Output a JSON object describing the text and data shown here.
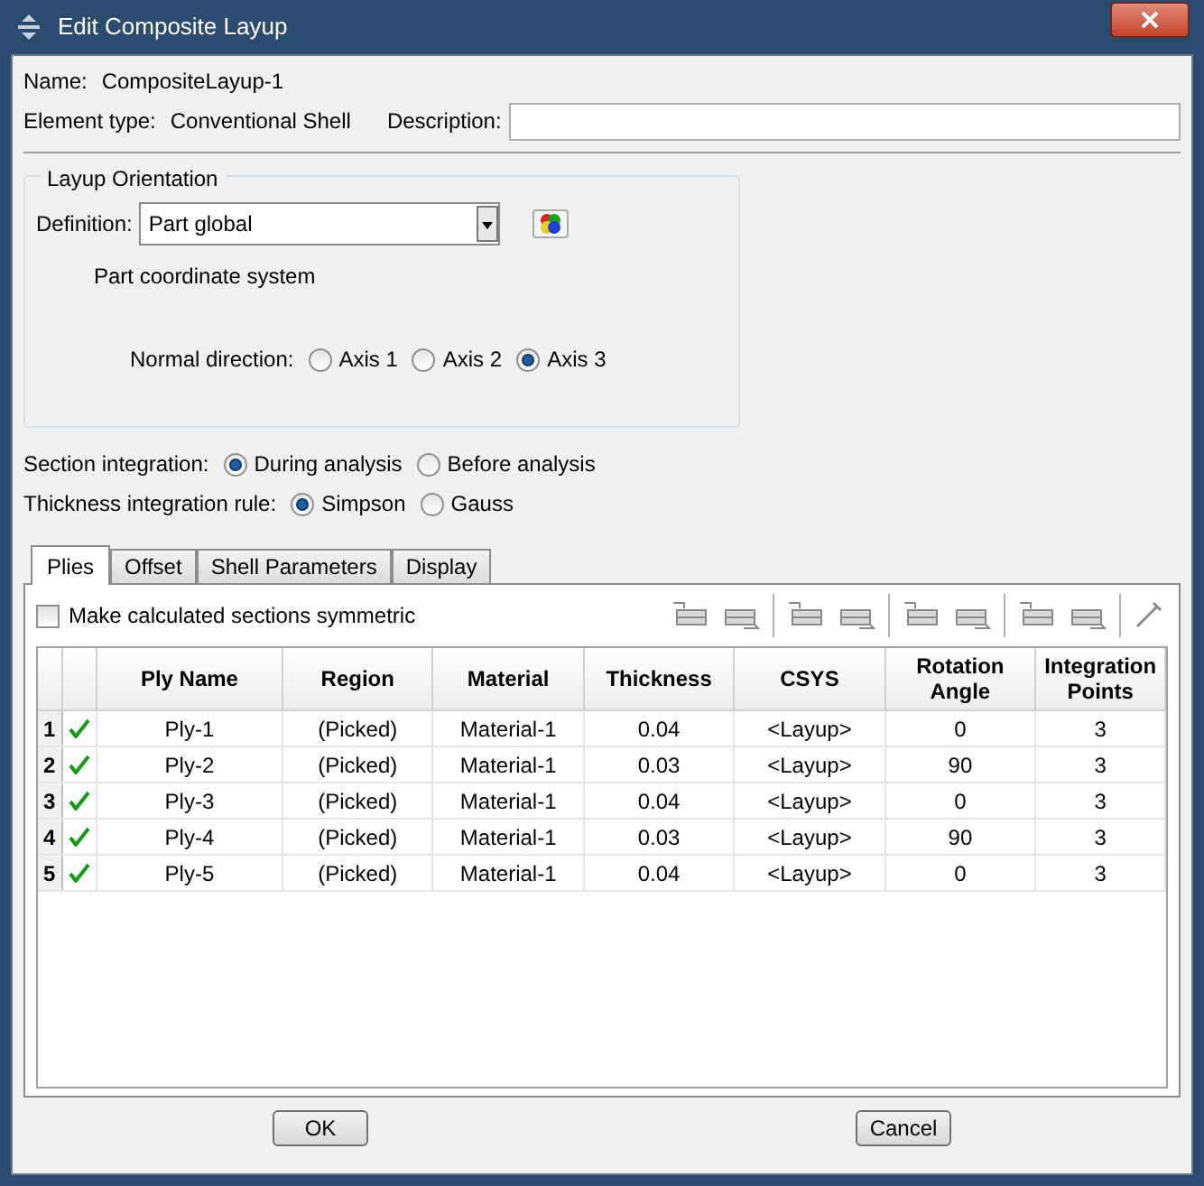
{
  "window": {
    "title": "Edit Composite Layup"
  },
  "name": {
    "label": "Name:",
    "value": "CompositeLayup-1"
  },
  "element_type": {
    "label": "Element type:",
    "value": "Conventional Shell"
  },
  "description": {
    "label": "Description:"
  },
  "layup_orientation": {
    "title": "Layup Orientation",
    "definition_label": "Definition:",
    "definition_value": "Part global",
    "note": "Part coordinate system",
    "normal_label": "Normal direction:",
    "normal_options": [
      {
        "label": "Axis 1",
        "selected": false
      },
      {
        "label": "Axis 2",
        "selected": false
      },
      {
        "label": "Axis 3",
        "selected": true
      }
    ]
  },
  "section_integration": {
    "label": "Section integration:",
    "options": [
      {
        "label": "During analysis",
        "selected": true
      },
      {
        "label": "Before analysis",
        "selected": false
      }
    ]
  },
  "thickness_rule": {
    "label": "Thickness integration rule:",
    "options": [
      {
        "label": "Simpson",
        "selected": true
      },
      {
        "label": "Gauss",
        "selected": false
      }
    ]
  },
  "tabs": [
    {
      "label": "Plies",
      "selected": true
    },
    {
      "label": "Offset",
      "selected": false
    },
    {
      "label": "Shell Parameters",
      "selected": false
    },
    {
      "label": "Display",
      "selected": false
    }
  ],
  "symmetric": {
    "label": "Make calculated sections symmetric",
    "checked": false
  },
  "table": {
    "columns": [
      "Ply Name",
      "Region",
      "Material",
      "Thickness",
      "CSYS",
      "Rotation Angle",
      "Integration Points"
    ],
    "rows": [
      {
        "number": "1",
        "valid": true,
        "cells": [
          "Ply-1",
          "(Picked)",
          "Material-1",
          "0.04",
          "<Layup>",
          "0",
          "3"
        ]
      },
      {
        "number": "2",
        "valid": true,
        "cells": [
          "Ply-2",
          "(Picked)",
          "Material-1",
          "0.03",
          "<Layup>",
          "90",
          "3"
        ]
      },
      {
        "number": "3",
        "valid": true,
        "cells": [
          "Ply-3",
          "(Picked)",
          "Material-1",
          "0.04",
          "<Layup>",
          "0",
          "3"
        ]
      },
      {
        "number": "4",
        "valid": true,
        "cells": [
          "Ply-4",
          "(Picked)",
          "Material-1",
          "0.03",
          "<Layup>",
          "90",
          "3"
        ]
      },
      {
        "number": "5",
        "valid": true,
        "cells": [
          "Ply-5",
          "(Picked)",
          "Material-1",
          "0.04",
          "<Layup>",
          "0",
          "3"
        ]
      }
    ]
  },
  "buttons": [
    "OK",
    "Cancel"
  ]
}
